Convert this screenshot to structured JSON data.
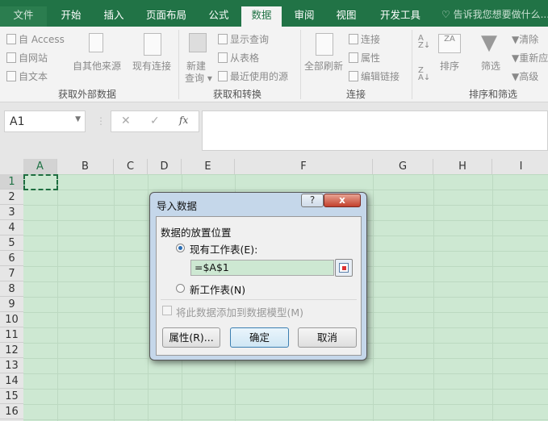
{
  "tabs": [
    "文件",
    "开始",
    "插入",
    "页面布局",
    "公式",
    "数据",
    "审阅",
    "视图",
    "开发工具"
  ],
  "active_tab": "数据",
  "tell_me": "告诉我您想要做什么...",
  "ribbon": {
    "get_external": {
      "access": "自 Access",
      "web": "自网站",
      "text": "自文本",
      "other": "自其他来源",
      "existing": "现有连接",
      "label": "获取外部数据"
    },
    "get_transform": {
      "new_query_1": "新建",
      "new_query_2": "查询",
      "show_queries": "显示查询",
      "from_table": "从表格",
      "recent": "最近使用的源",
      "label": "获取和转换"
    },
    "connections": {
      "refresh_all": "全部刷新",
      "connections": "连接",
      "properties": "属性",
      "edit_links": "编辑链接",
      "label": "连接"
    },
    "sort_filter": {
      "sort": "排序",
      "filter": "筛选",
      "clear": "清除",
      "reapply": "重新应用",
      "advanced": "高级",
      "label": "排序和筛选"
    }
  },
  "name_box": "A1",
  "fx": "fx",
  "columns": [
    "A",
    "B",
    "C",
    "D",
    "E",
    "F",
    "G",
    "H",
    "I"
  ],
  "rows": [
    "1",
    "2",
    "3",
    "4",
    "5",
    "6",
    "7",
    "8",
    "9",
    "10",
    "11",
    "12",
    "13",
    "14",
    "15",
    "16"
  ],
  "dialog": {
    "title": "导入数据",
    "help": "?",
    "close": "x",
    "section": "数据的放置位置",
    "existing_sheet": "现有工作表(E):",
    "existing_selected": true,
    "reference": "=$A$1",
    "new_sheet": "新工作表(N)",
    "add_model": "将此数据添加到数据模型(M)",
    "properties_btn": "属性(R)...",
    "ok_btn": "确定",
    "cancel_btn": "取消"
  }
}
